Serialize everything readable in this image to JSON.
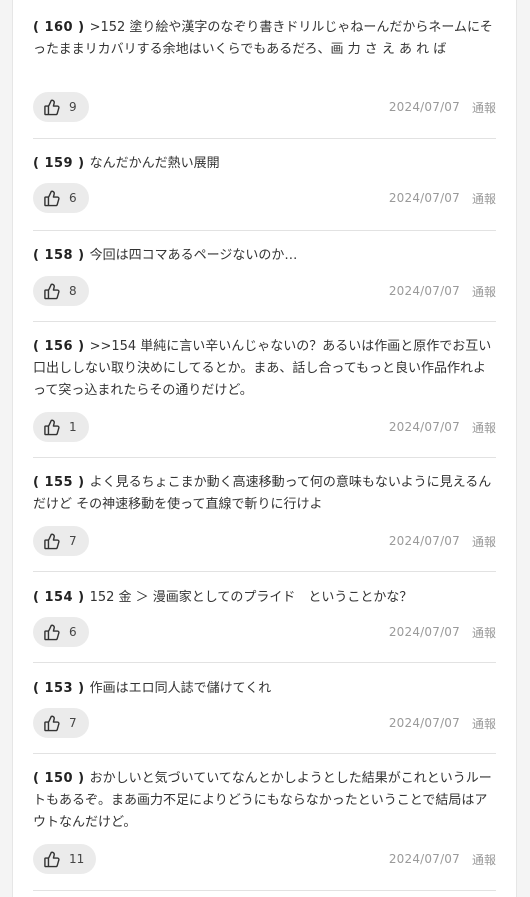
{
  "comments": [
    {
      "number": "( 160 )",
      "text": ">152 塗り絵や漢字のなぞり書きドリルじゃねーんだからネームにそったままリカバリする余地はいくらでもあるだろ、画 力 さ え あ れ ば",
      "likes": "9",
      "date": "2024/07/07",
      "report": "通報"
    },
    {
      "number": "( 159 )",
      "text": "なんだかんだ熱い展開",
      "likes": "6",
      "date": "2024/07/07",
      "report": "通報"
    },
    {
      "number": "( 158 )",
      "text": "今回は四コマあるページないのか…",
      "likes": "8",
      "date": "2024/07/07",
      "report": "通報"
    },
    {
      "number": "( 156 )",
      "text": ">>154 単純に言い辛いんじゃないの？あるいは作画と原作でお互い口出ししない取り決めにしてるとか。まあ、話し合ってもっと良い作品作れよって突っ込まれたらその通りだけど。",
      "likes": "1",
      "date": "2024/07/07",
      "report": "通報"
    },
    {
      "number": "( 155 )",
      "text": "よく見るちょこまか動く高速移動って何の意味もないように見えるんだけど その神速移動を使って直線で斬りに行けよ",
      "likes": "7",
      "date": "2024/07/07",
      "report": "通報"
    },
    {
      "number": "( 154 )",
      "text": "152 金 ＞ 漫画家としてのプライド　ということかな？",
      "likes": "6",
      "date": "2024/07/07",
      "report": "通報"
    },
    {
      "number": "( 153 )",
      "text": "作画はエロ同人誌で儲けてくれ",
      "likes": "7",
      "date": "2024/07/07",
      "report": "通報"
    },
    {
      "number": "( 150 )",
      "text": "おかしいと気づいていてなんとかしようとした結果がこれというルートもあるぞ。まあ画力不足によりどうにもならなかったということで結局はアウトなんだけど。",
      "likes": "11",
      "date": "2024/07/07",
      "report": "通報"
    }
  ],
  "icons": {
    "like": "thumbs-up-icon"
  },
  "colors": {
    "background": "#f4f4f4",
    "panel": "#ffffff",
    "like_button": "#ebebeb",
    "meta_text": "#9a9a9a",
    "divider": "#e2e2e2"
  }
}
